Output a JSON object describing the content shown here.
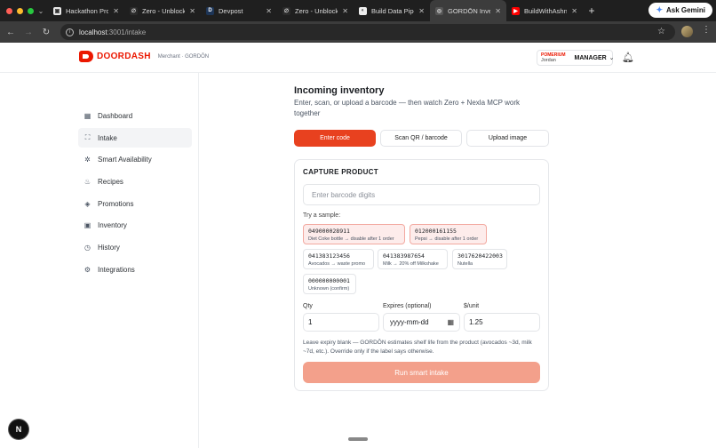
{
  "browser": {
    "tabs": [
      {
        "title": "Hackathon Prod",
        "fav_color": "#e8e8e8",
        "fav_glyph": "▣"
      },
      {
        "title": "Zero - Unblock",
        "fav_color": "#2b2b2b",
        "fav_glyph": "∅"
      },
      {
        "title": "Devpost",
        "fav_color": "#1d3557",
        "fav_glyph": "D"
      },
      {
        "title": "Zero - Unblock",
        "fav_color": "#2b2b2b",
        "fav_glyph": "∅"
      },
      {
        "title": "Build Data Pipel",
        "fav_color": "#eeeeee",
        "fav_glyph": "◐"
      },
      {
        "title": "GORDŌN Invent",
        "fav_color": "#555555",
        "fav_glyph": "◎"
      },
      {
        "title": "BuildWithAshna",
        "fav_color": "#ff0000",
        "fav_glyph": "▶"
      }
    ],
    "ask_gemini": "Ask Gemini",
    "url_host": "localhost",
    "url_path": ":3001/intake"
  },
  "header": {
    "brand": "DOORDASH",
    "brand_sub": "Merchant · GORDŌN",
    "user_org": "POMERIUM",
    "user_name": "Jordan",
    "user_role": "MANAGER"
  },
  "sidebar": {
    "items": [
      {
        "label": "Dashboard",
        "icon": "grid-icon",
        "glyph": "▦"
      },
      {
        "label": "Intake",
        "icon": "scan-icon",
        "glyph": "⛶"
      },
      {
        "label": "Smart Availability",
        "icon": "sparkle-icon",
        "glyph": "✲"
      },
      {
        "label": "Recipes",
        "icon": "chef-hat-icon",
        "glyph": "♨"
      },
      {
        "label": "Promotions",
        "icon": "tag-icon",
        "glyph": "◈"
      },
      {
        "label": "Inventory",
        "icon": "box-icon",
        "glyph": "▣"
      },
      {
        "label": "History",
        "icon": "clock-icon",
        "glyph": "◷"
      },
      {
        "label": "Integrations",
        "icon": "gear-icon",
        "glyph": "⚙"
      }
    ],
    "active_index": 1
  },
  "main": {
    "title": "Incoming inventory",
    "subtitle": "Enter, scan, or upload a barcode — then watch Zero + Nexla MCP work together",
    "modes": [
      "Enter code",
      "Scan QR / barcode",
      "Upload image"
    ],
    "active_mode": 0,
    "card_title": "CAPTURE PRODUCT",
    "barcode_placeholder": "Enter barcode digits",
    "sample_label": "Try a sample:",
    "samples": [
      {
        "code": "049000028911",
        "desc": "Diet Coke bottle → disable after 1 order",
        "highlight": true
      },
      {
        "code": "012000161155",
        "desc": "Pepsi → disable after 1 order",
        "highlight": true
      },
      {
        "code": "041383123456",
        "desc": "Avocados → waste promo",
        "highlight": false
      },
      {
        "code": "041383987654",
        "desc": "Milk → 20% off Milkshake",
        "highlight": false
      },
      {
        "code": "3017620422003",
        "desc": "Nutella",
        "highlight": false
      },
      {
        "code": "000000000001",
        "desc": "Unknown (confirm)",
        "highlight": false
      }
    ],
    "qty_label": "Qty",
    "qty_value": "1",
    "expires_label": "Expires (optional)",
    "expires_placeholder": "yyyy-mm-dd",
    "unit_label": "$/unit",
    "unit_value": "1.25",
    "help": "Leave expiry blank — GORDŌN estimates shelf life from the product (avocados ~3d, milk ~7d, etc.). Override only if the label says otherwise.",
    "run_label": "Run smart intake"
  },
  "dev_badge": "N"
}
